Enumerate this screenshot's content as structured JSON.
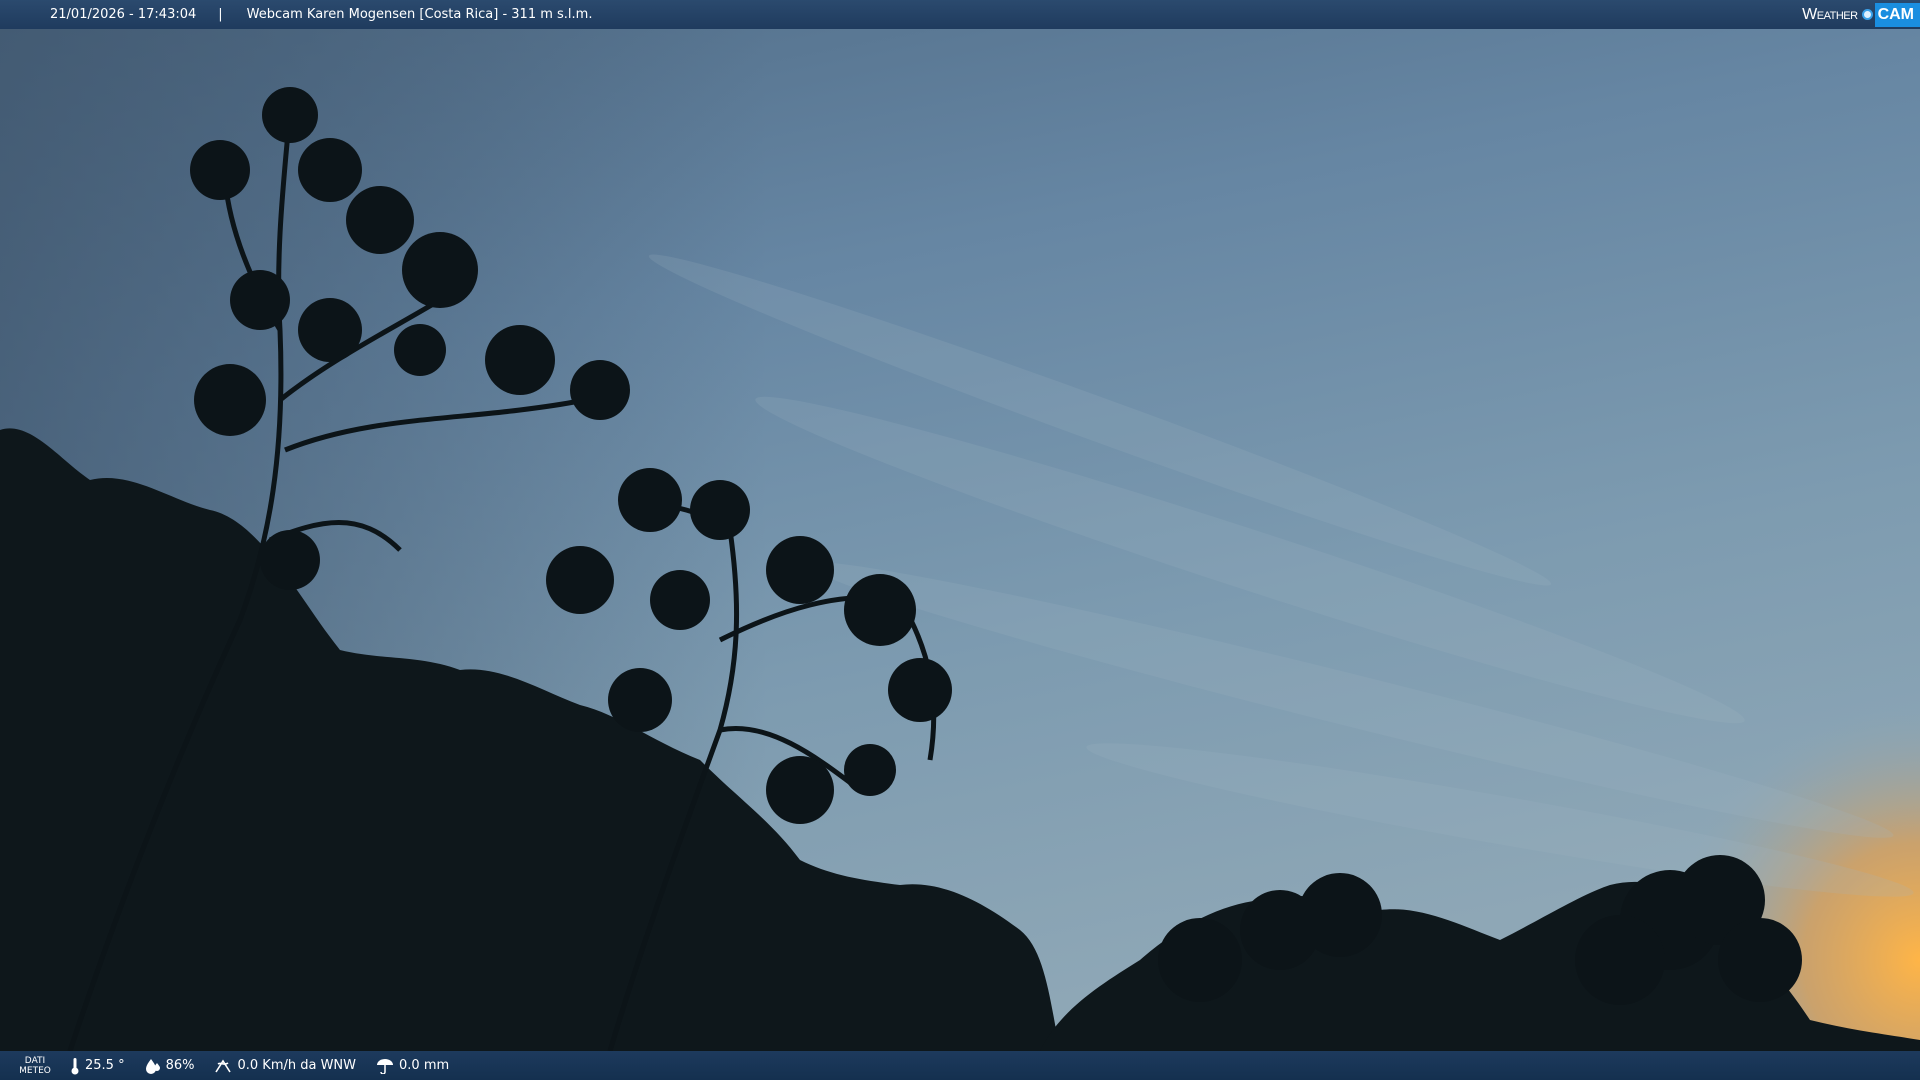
{
  "header": {
    "timestamp": "21/01/2026 - 17:43:04",
    "separator": "|",
    "title": "Webcam Karen Mogensen [Costa Rica]  - 311 m s.l.m."
  },
  "logo": {
    "word": "Weather",
    "cam": "CAM"
  },
  "footer": {
    "dati_line1": "DATI",
    "dati_line2": "METEO",
    "temperature": "25.5 °",
    "humidity": "86%",
    "wind": "0.0 Km/h da WNW",
    "rain": "0.0 mm"
  },
  "icons": {
    "temperature": "thermometer-icon",
    "humidity": "humidity-icon",
    "wind": "wind-icon",
    "rain": "rain-icon"
  },
  "colors": {
    "sky_top": "#5a7a98",
    "sky_mid": "#7797ad",
    "sunset": "#f0a53a",
    "foliage": "#0f1a1d",
    "bar": "#1f3b5e"
  }
}
